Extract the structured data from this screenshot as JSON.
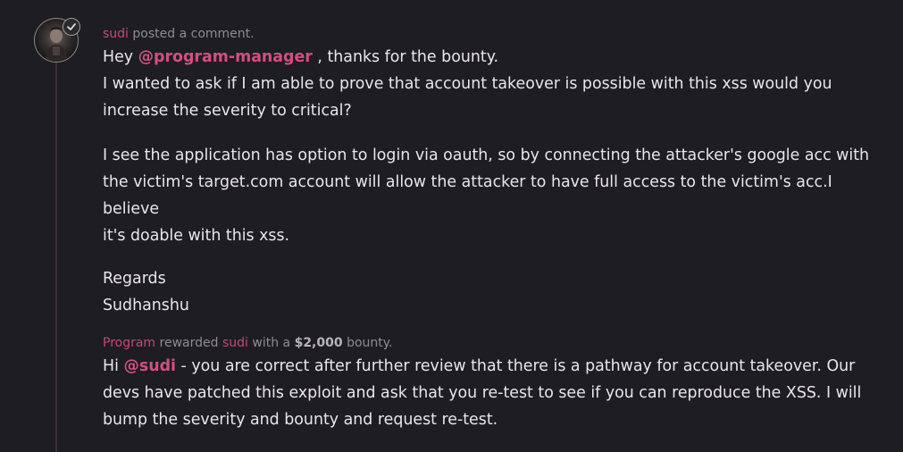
{
  "comment": {
    "username": "sudi",
    "action": "posted a comment.",
    "greeting_prefix": "Hey",
    "mention": "@program-manager",
    "greeting_suffix": ", thanks for the bounty.",
    "line1": "I wanted to ask if I am able to prove that account takeover is possible with this xss would you",
    "line2": "increase the severity to critical?",
    "para2_line1": "I see the application has option to login via oauth, so by connecting the attacker's google acc with",
    "para2_line2": "the victim's target.com account will allow the attacker to have full access to the victim's acc.I believe",
    "para2_line3": "it's doable with this xss.",
    "regards": "Regards",
    "signature": "Sudhanshu"
  },
  "reward": {
    "actor": "Program",
    "action_text": "rewarded",
    "recipient": "sudi",
    "with_text": "with a",
    "amount": "$2,000",
    "bounty_text": "bounty.",
    "greeting": "Hi",
    "mention": "@sudi",
    "line1_rest": "- you are correct after further review that there is a pathway for account takeover. Our",
    "line2": "devs have patched this exploit and ask that you re-test to see if you can reproduce the XSS. I will",
    "line3": "bump the severity and bounty and request re-test."
  },
  "icons": {
    "avatar": "user-avatar-photo",
    "badge": "verified-check-icon"
  },
  "colors": {
    "background": "#1e1d21",
    "accent": "#d04f83",
    "text": "#e9e6ea",
    "meta": "#8f8b92"
  }
}
